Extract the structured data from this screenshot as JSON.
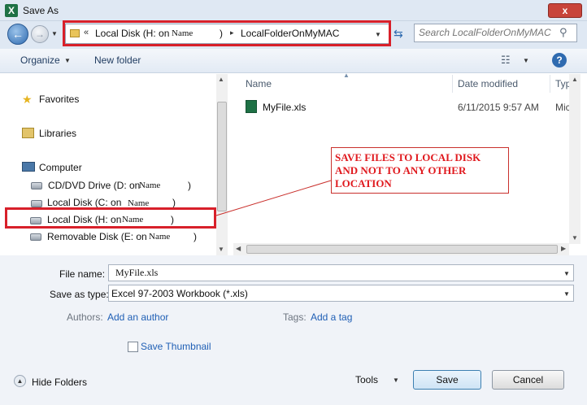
{
  "window": {
    "title": "Save As",
    "app_icon": "X",
    "close_label": "x"
  },
  "address": {
    "crumb_chevron": "«",
    "crumb1": "Local Disk (H: on",
    "crumb1_name": "Name",
    "crumb1_paren": ")",
    "crumb_sep": "▸",
    "crumb2": "LocalFolderOnMyMAC"
  },
  "search": {
    "placeholder": "Search LocalFolderOnMyMAC"
  },
  "toolbar": {
    "organize": "Organize",
    "new_folder": "New folder",
    "help": "?"
  },
  "nav": {
    "favorites": "Favorites",
    "libraries": "Libraries",
    "computer": "Computer",
    "dvd": {
      "label": "CD/DVD Drive (D: on",
      "name": "Name",
      "paren": ")"
    },
    "c_drive": {
      "label": "Local Disk (C: on",
      "name": "Name",
      "paren": ")"
    },
    "h_drive": {
      "label": "Local Disk (H: on",
      "name": "Name",
      "paren": ")"
    },
    "e_drive": {
      "label": "Removable Disk (E: on",
      "name": "Name",
      "paren": ")"
    }
  },
  "filelist": {
    "columns": [
      "Name",
      "Date modified",
      "Type"
    ],
    "rows": [
      {
        "name": "MyFile.xls",
        "date": "6/11/2015 9:57 AM",
        "type": "Micro"
      }
    ]
  },
  "callout": {
    "text": "SAVE FILES TO LOCAL DISK AND NOT TO ANY OTHER LOCATION",
    "color": "#e0191e"
  },
  "form": {
    "file_name_label": "File name:",
    "file_name_value": "MyFile.xls",
    "save_type_label": "Save as type:",
    "save_type_value": "Excel 97-2003 Workbook (*.xls)",
    "authors_label": "Authors:",
    "authors_link": "Add an author",
    "tags_label": "Tags:",
    "tags_link": "Add a tag",
    "thumbnail_label": "Save Thumbnail"
  },
  "footer": {
    "hide_folders": "Hide Folders",
    "tools": "Tools",
    "save": "Save",
    "cancel": "Cancel"
  }
}
